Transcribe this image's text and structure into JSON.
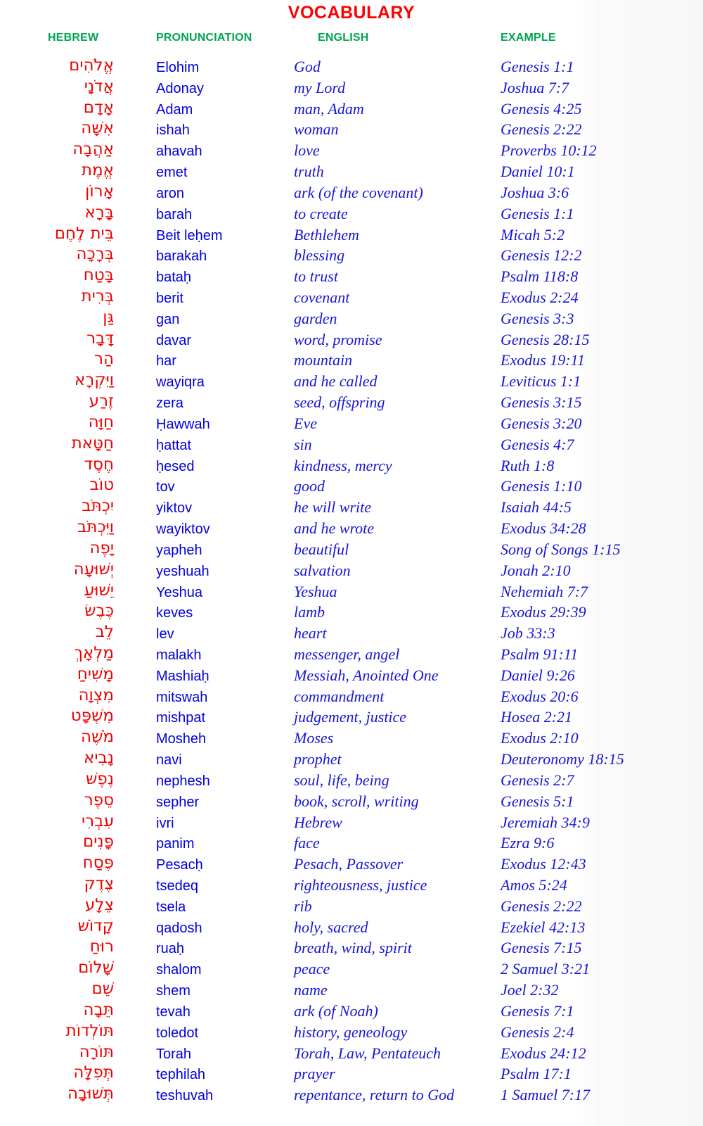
{
  "title": "VOCABULARY",
  "colors": {
    "title": "#FF0000",
    "hebrew": "#EE0000",
    "header": "#00A550",
    "latin": "#0000DD"
  },
  "headers": {
    "hebrew": "HEBREW",
    "pronunciation": "PRONUNCIATION",
    "english": "ENGLISH",
    "example": "EXAMPLE"
  },
  "rows": [
    {
      "hebrew": "אֱלֹהִים",
      "pronunciation": "Elohim",
      "english": "God",
      "example": "Genesis 1:1"
    },
    {
      "hebrew": "אֲדֹנָי",
      "pronunciation": "Adonay",
      "english": "my Lord",
      "example": "Joshua 7:7"
    },
    {
      "hebrew": "אָדָם",
      "pronunciation": "Adam",
      "english": "man, Adam",
      "example": "Genesis 4:25"
    },
    {
      "hebrew": "אִשָּׁה",
      "pronunciation": "ishah",
      "english": "woman",
      "example": "Genesis 2:22"
    },
    {
      "hebrew": "אַהֲבָה",
      "pronunciation": "ahavah",
      "english": "love",
      "example": "Proverbs 10:12"
    },
    {
      "hebrew": "אֱמֶת",
      "pronunciation": "emet",
      "english": "truth",
      "example": "Daniel 10:1"
    },
    {
      "hebrew": "אָרוֹן",
      "pronunciation": "aron",
      "english": "ark (of the covenant)",
      "example": "Joshua 3:6"
    },
    {
      "hebrew": "בָּרָא",
      "pronunciation": "barah",
      "english": "to create",
      "example": "Genesis 1:1"
    },
    {
      "hebrew": "בֵּית לֶחֶם",
      "pronunciation": "Beit leḥem",
      "english": "Bethlehem",
      "example": "Micah 5:2"
    },
    {
      "hebrew": "בְּרָכָה",
      "pronunciation": "barakah",
      "english": "blessing",
      "example": "Genesis 12:2"
    },
    {
      "hebrew": "בָּטַח",
      "pronunciation": "bataḥ",
      "english": "to trust",
      "example": "Psalm 118:8"
    },
    {
      "hebrew": "בְּרִית",
      "pronunciation": "berit",
      "english": "covenant",
      "example": "Exodus 2:24"
    },
    {
      "hebrew": "גַּן",
      "pronunciation": "gan",
      "english": "garden",
      "example": "Genesis 3:3"
    },
    {
      "hebrew": "דָּבָר",
      "pronunciation": "davar",
      "english": "word, promise",
      "example": "Genesis 28:15"
    },
    {
      "hebrew": "הַר",
      "pronunciation": "har",
      "english": "mountain",
      "example": "Exodus 19:11"
    },
    {
      "hebrew": "וַיִּקְרָא",
      "pronunciation": "wayiqra",
      "english": "and he called",
      "example": "Leviticus 1:1"
    },
    {
      "hebrew": "זֶרַע",
      "pronunciation": "zera",
      "english": "seed, offspring",
      "example": "Genesis 3:15"
    },
    {
      "hebrew": "חַוָּה",
      "pronunciation": "Ḥawwah",
      "english": "Eve",
      "example": "Genesis 3:20"
    },
    {
      "hebrew": "חַטָּאת",
      "pronunciation": "ḥattat",
      "english": "sin",
      "example": "Genesis 4:7"
    },
    {
      "hebrew": "חֶסֶד",
      "pronunciation": "ḥesed",
      "english": "kindness, mercy",
      "example": "Ruth 1:8"
    },
    {
      "hebrew": "טוֹב",
      "pronunciation": "tov",
      "english": "good",
      "example": "Genesis 1:10"
    },
    {
      "hebrew": "יִכְתֹּב",
      "pronunciation": "yiktov",
      "english": "he will write",
      "example": "Isaiah 44:5"
    },
    {
      "hebrew": "וַיִּכְתֹּב",
      "pronunciation": "wayiktov",
      "english": "and he wrote",
      "example": "Exodus 34:28"
    },
    {
      "hebrew": "יָפֶה",
      "pronunciation": "yapheh",
      "english": "beautiful",
      "example": "Song of Songs 1:15"
    },
    {
      "hebrew": "יְשׁוּעָה",
      "pronunciation": "yeshuah",
      "english": "salvation",
      "example": "Jonah 2:10"
    },
    {
      "hebrew": "יֵשׁוּעַ",
      "pronunciation": "Yeshua",
      "english": "Yeshua",
      "example": "Nehemiah 7:7"
    },
    {
      "hebrew": "כֶּבֶשׂ",
      "pronunciation": "keves",
      "english": "lamb",
      "example": "Exodus 29:39"
    },
    {
      "hebrew": "לֵב",
      "pronunciation": "lev",
      "english": "heart",
      "example": "Job 33:3"
    },
    {
      "hebrew": "מַלְאָךְ",
      "pronunciation": "malakh",
      "english": "messenger, angel",
      "example": "Psalm 91:11"
    },
    {
      "hebrew": "מָשִׁיחַ",
      "pronunciation": "Mashiaḥ",
      "english": "Messiah, Anointed One",
      "example": "Daniel 9:26"
    },
    {
      "hebrew": "מִצְוָה",
      "pronunciation": "mitswah",
      "english": "commandment",
      "example": "Exodus 20:6"
    },
    {
      "hebrew": "מִשְׁפָּט",
      "pronunciation": "mishpat",
      "english": "judgement, justice",
      "example": "Hosea 2:21"
    },
    {
      "hebrew": "מֹשֶׁה",
      "pronunciation": "Mosheh",
      "english": "Moses",
      "example": "Exodus 2:10"
    },
    {
      "hebrew": "נָבִיא",
      "pronunciation": "navi",
      "english": "prophet",
      "example": "Deuteronomy 18:15"
    },
    {
      "hebrew": "נֶפֶשׁ",
      "pronunciation": "nephesh",
      "english": "soul, life, being",
      "example": "Genesis 2:7"
    },
    {
      "hebrew": "סֵפֶר",
      "pronunciation": "sepher",
      "english": "book, scroll, writing",
      "example": "Genesis 5:1"
    },
    {
      "hebrew": "עִבְרִי",
      "pronunciation": "ivri",
      "english": "Hebrew",
      "example": "Jeremiah 34:9"
    },
    {
      "hebrew": "פָּנִים",
      "pronunciation": "panim",
      "english": "face",
      "example": "Ezra 9:6"
    },
    {
      "hebrew": "פֶּסַח",
      "pronunciation": "Pesacḥ",
      "english": "Pesach, Passover",
      "example": "Exodus 12:43"
    },
    {
      "hebrew": "צֶדֶק",
      "pronunciation": "tsedeq",
      "english": "righteousness, justice",
      "example": "Amos 5:24"
    },
    {
      "hebrew": "צֵלָע",
      "pronunciation": "tsela",
      "english": "rib",
      "example": "Genesis 2:22"
    },
    {
      "hebrew": "קָדוֹשׁ",
      "pronunciation": "qadosh",
      "english": "holy, sacred",
      "example": "Ezekiel 42:13"
    },
    {
      "hebrew": "רוּחַ",
      "pronunciation": "ruaḥ",
      "english": "breath, wind, spirit",
      "example": "Genesis 7:15"
    },
    {
      "hebrew": "שָׁלוֹם",
      "pronunciation": "shalom",
      "english": "peace",
      "example": "2 Samuel 3:21"
    },
    {
      "hebrew": "שֵׁם",
      "pronunciation": "shem",
      "english": "name",
      "example": "Joel 2:32"
    },
    {
      "hebrew": "תֵּבָה",
      "pronunciation": "tevah",
      "english": "ark (of Noah)",
      "example": "Genesis 7:1"
    },
    {
      "hebrew": "תּוֹלְדוֹת",
      "pronunciation": "toledot",
      "english": "history, geneology",
      "example": "Genesis 2:4"
    },
    {
      "hebrew": "תּוֹרָה",
      "pronunciation": "Torah",
      "english": "Torah, Law, Pentateuch",
      "example": "Exodus 24:12"
    },
    {
      "hebrew": "תְּפִלָּה",
      "pronunciation": "tephilah",
      "english": "prayer",
      "example": "Psalm 17:1"
    },
    {
      "hebrew": "תְּשׁוּבָה",
      "pronunciation": "teshuvah",
      "english": "repentance, return to God",
      "example": "1 Samuel 7:17"
    }
  ]
}
